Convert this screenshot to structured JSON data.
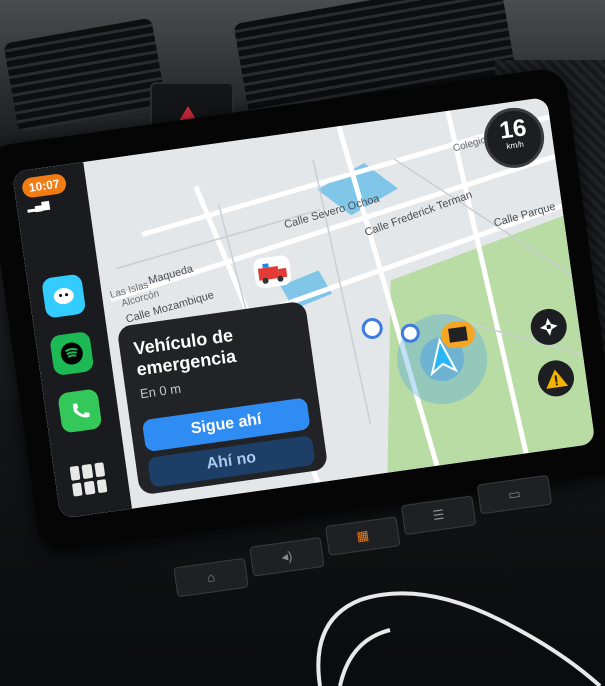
{
  "status_bar": {
    "time": "10:07",
    "signal": ""
  },
  "map": {
    "streets": [
      "Maqueda",
      "Calle Mozambique",
      "Calle Severo Ochoa",
      "Calle Frederick Terman",
      "Calle Parque"
    ],
    "places": [
      "Las Islas",
      "Alcorcón",
      "Colegio M."
    ]
  },
  "speedometer": {
    "speed": "16",
    "unit": "km/h"
  },
  "alert": {
    "title": "Vehículo de emergencia",
    "distance": "En 0 m",
    "confirm_label": "Sigue ahí",
    "dismiss_label": "Ahí no"
  },
  "dock_apps": [
    "waze-app-icon",
    "spotify-app-icon",
    "phone-app-icon"
  ],
  "colors": {
    "time_pill": "#f07c13",
    "confirm": "#2f8cf3",
    "dismiss": "#1d3e66",
    "hazard": "#d22a3c",
    "map_water": "#7fc6e8",
    "map_park": "#b9dca5"
  }
}
